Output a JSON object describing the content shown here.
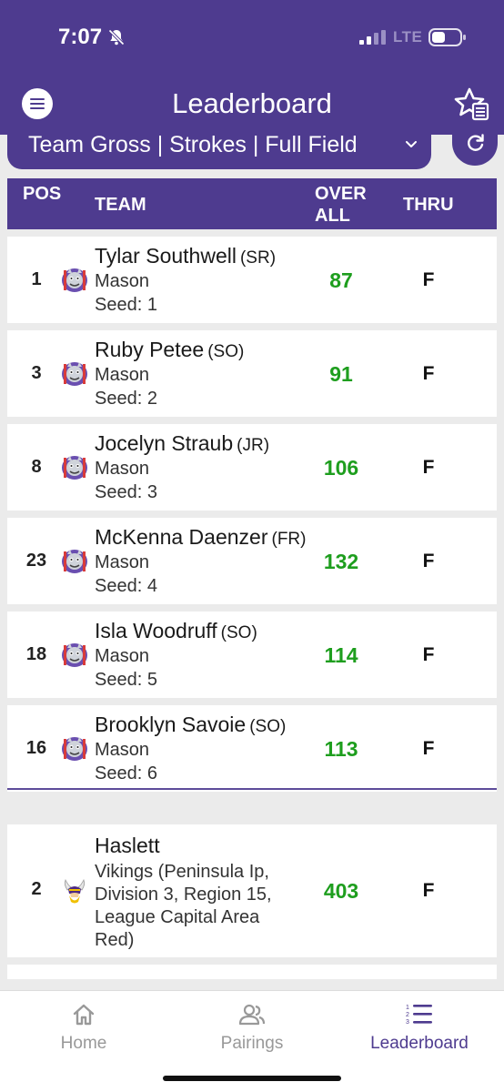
{
  "status": {
    "time": "7:07",
    "network": "LTE"
  },
  "header": {
    "title": "Leaderboard"
  },
  "filter": {
    "label": "Team Gross | Strokes | Full Field"
  },
  "table_headers": {
    "pos": "POS",
    "team": "TEAM",
    "overall": "OVER ALL",
    "thru": "THRU"
  },
  "players": [
    {
      "pos": "1",
      "name": "Tylar Southwell",
      "class": "(SR)",
      "team": "Mason",
      "seed": "Seed: 1",
      "score": "87",
      "thru": "F"
    },
    {
      "pos": "3",
      "name": "Ruby Petee",
      "class": "(SO)",
      "team": "Mason",
      "seed": "Seed: 2",
      "score": "91",
      "thru": "F"
    },
    {
      "pos": "8",
      "name": "Jocelyn Straub",
      "class": "(JR)",
      "team": "Mason",
      "seed": "Seed: 3",
      "score": "106",
      "thru": "F"
    },
    {
      "pos": "23",
      "name": "McKenna Daenzer",
      "class": "(FR)",
      "team": "Mason",
      "seed": "Seed: 4",
      "score": "132",
      "thru": "F"
    },
    {
      "pos": "18",
      "name": "Isla Woodruff",
      "class": "(SO)",
      "team": "Mason",
      "seed": "Seed: 5",
      "score": "114",
      "thru": "F"
    },
    {
      "pos": "16",
      "name": "Brooklyn Savoie",
      "class": "(SO)",
      "team": "Mason",
      "seed": "Seed: 6",
      "score": "113",
      "thru": "F"
    }
  ],
  "team_row": {
    "pos": "2",
    "name": "Haslett",
    "detail": "Vikings (Peninsula Ip, Division 3, Region 15, League Capital Area Red)",
    "score": "403",
    "thru": "F"
  },
  "tabs": [
    {
      "label": "Home",
      "icon": "home-icon",
      "active": false
    },
    {
      "label": "Pairings",
      "icon": "pairings-icon",
      "active": false
    },
    {
      "label": "Leaderboard",
      "icon": "leaderboard-icon",
      "active": true
    }
  ],
  "colors": {
    "brand": "#4e3b8f",
    "score": "#1e9e1e",
    "tab_active": "#4e3b8f",
    "tab_inactive": "#999999"
  }
}
